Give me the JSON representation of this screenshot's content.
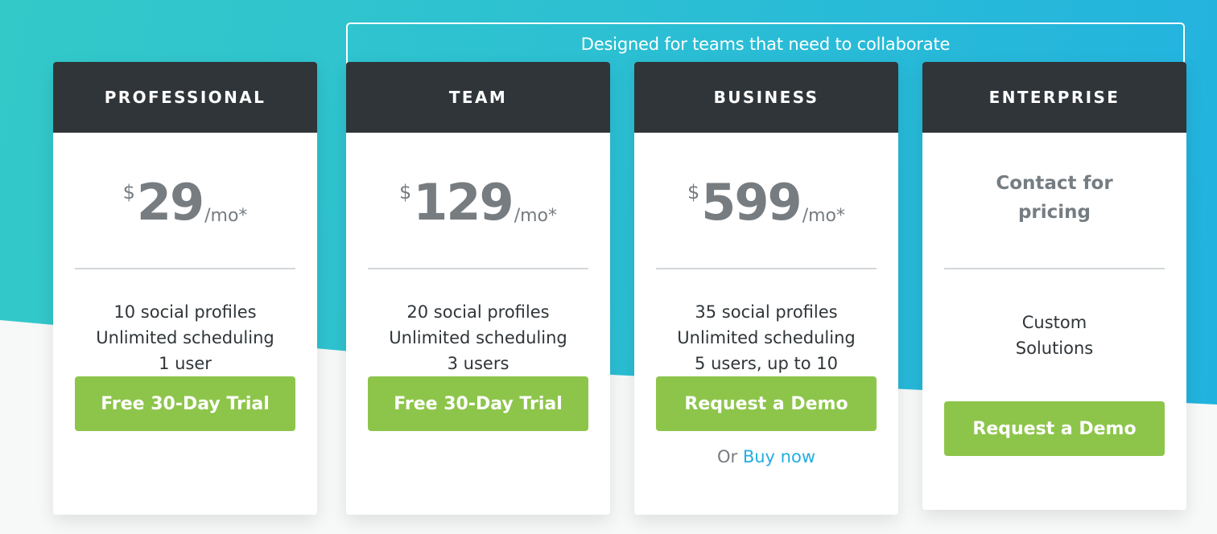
{
  "background": {
    "gradient_colors": [
      "#33c9c9",
      "#22b2e0"
    ],
    "page_color": "#f7f8f8"
  },
  "team_banner": {
    "text": "Designed for teams that need to collaborate"
  },
  "colors": {
    "header_bg": "#2f3539",
    "cta_green": "#8dc54b",
    "price_gray": "#767c80",
    "link_blue": "#22aee3"
  },
  "plans": [
    {
      "name": "PROFESSIONAL",
      "currency": "$",
      "amount": "29",
      "period": "/mo*",
      "features": [
        "10 social profiles",
        "Unlimited scheduling",
        "1 user"
      ],
      "cta_label": "Free 30-Day Trial"
    },
    {
      "name": "TEAM",
      "currency": "$",
      "amount": "129",
      "period": "/mo*",
      "features": [
        "20 social profiles",
        "Unlimited scheduling",
        "3 users"
      ],
      "cta_label": "Free 30-Day Trial"
    },
    {
      "name": "BUSINESS",
      "currency": "$",
      "amount": "599",
      "period": "/mo*",
      "features": [
        "35 social profiles",
        "Unlimited scheduling",
        "5 users, up to 10"
      ],
      "cta_label": "Request a Demo",
      "secondary_prefix": "Or",
      "secondary_link": "Buy now"
    },
    {
      "name": "ENTERPRISE",
      "price_text_line1": "Contact for",
      "price_text_line2": "pricing",
      "features": [
        "Custom",
        "Solutions"
      ],
      "cta_label": "Request a Demo"
    }
  ]
}
